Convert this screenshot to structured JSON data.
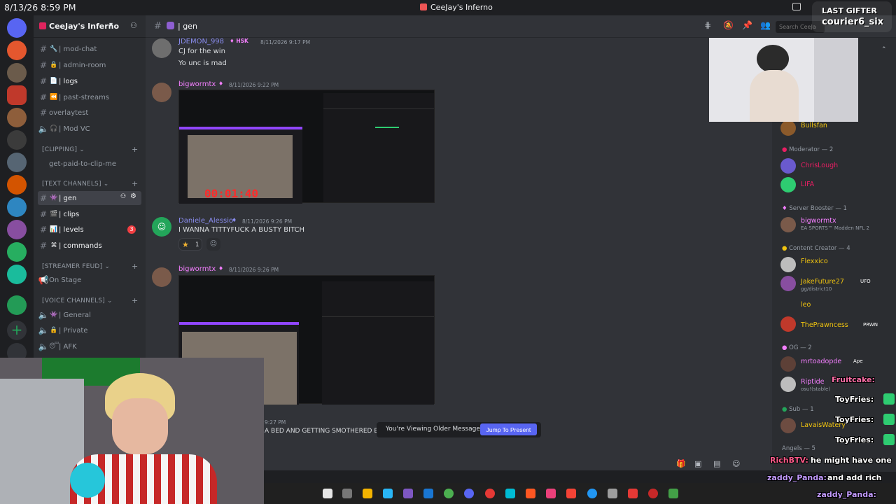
{
  "system": {
    "time": "8/13/26 8:59 PM",
    "window_title": "CeeJay's Inferno"
  },
  "server": {
    "name": "CeeJay's Inferno"
  },
  "channel_header": {
    "name": "| gen",
    "search_placeholder": "Search CeeJa"
  },
  "sidebar": {
    "channels": [
      {
        "label": "| mod-chat"
      },
      {
        "label": "| admin-room"
      },
      {
        "label": "| logs"
      },
      {
        "label": "| past-streams"
      },
      {
        "label": "overlaytest"
      },
      {
        "label": "| Mod VC"
      }
    ],
    "cat_clipping": "[CLIPPING]",
    "clip_channel": "get-paid-to-clip-me",
    "cat_text": "[TEXT CHANNELS]",
    "text_channels": [
      {
        "label": "| gen"
      },
      {
        "label": "| clips"
      },
      {
        "label": "| levels",
        "badge": "3"
      },
      {
        "label": "| commands"
      }
    ],
    "cat_feud": "[STREAMER FEUD]",
    "feud_channel": "On Stage",
    "cat_voice": "[VOICE CHANNELS]",
    "voice_channels": [
      {
        "label": "| General"
      },
      {
        "label": "| Private"
      },
      {
        "label": "| AFK"
      }
    ]
  },
  "messages": [
    {
      "author": "JDEMON_998",
      "tag": "HSK",
      "time": "8/11/2026 9:17 PM",
      "lines": [
        "CJ for the win",
        "Yo unc is mad"
      ]
    },
    {
      "author": "bigwormtx",
      "time": "8/11/2026 9:22 PM",
      "timer_overlay": "00:01:40"
    },
    {
      "author": "Daniele_Alessio",
      "time": "8/11/2026 9:26 PM",
      "lines": [
        "I WANNA TITTYFUCK A BUSTY BITCH"
      ],
      "reaction_count": "1"
    },
    {
      "author": "bigwormtx",
      "time": "8/11/2026 9:26 PM"
    },
    {
      "time": "9:27 PM",
      "lines": "A BED AND GETTING SMOTHERED B"
    }
  ],
  "banner": {
    "text": "You're Viewing Older Messages",
    "button": "Jump To Present"
  },
  "members": {
    "top": "Bullsfan",
    "groups": [
      {
        "role": "Moderator — 2",
        "members": [
          "ChrisLough",
          "LIFA"
        ]
      },
      {
        "role": "Server Booster — 1",
        "members": [
          "bigwormtx"
        ],
        "activity": "EA SPORTS™ Madden NFL 2"
      },
      {
        "role": "Content Creator — 4",
        "members": [
          "Flexxico",
          "JakeFuture27",
          "leo",
          "ThePrawncess"
        ],
        "tags": [
          "UFO",
          "PRWN"
        ],
        "activity": "gg/district10"
      },
      {
        "role": "OG — 2",
        "members": [
          "mrtoadopde",
          "Riptide"
        ],
        "tags": [
          "Ape"
        ],
        "activity": "osu!(stable)"
      },
      {
        "role": "Sub — 1",
        "members": [
          "LavaisWatery"
        ]
      },
      {
        "role": "Angels — 5"
      }
    ]
  },
  "overlay": {
    "last_gifter_label": "LAST GIFTER",
    "last_gifter_name": "courier6_six",
    "chat": [
      {
        "user": "Fruitcake:",
        "text": ""
      },
      {
        "user": "ToyFries:",
        "text": ""
      },
      {
        "user": "ToyFries:",
        "text": ""
      },
      {
        "user": "ToyFries:",
        "text": ""
      },
      {
        "user": "RichBTV:",
        "text": "he might have one"
      },
      {
        "user": "zaddy_Panda:",
        "text": "and add rich"
      },
      {
        "user": "zaddy_Panda:",
        "text": ""
      }
    ]
  },
  "colors": {
    "accent": "#5865f2",
    "mod": "#e91e63",
    "creator": "#f1c40f",
    "booster": "#f47fff",
    "og": "#f47fff"
  }
}
